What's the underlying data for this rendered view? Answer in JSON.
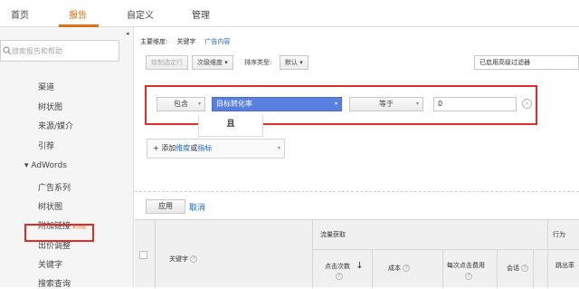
{
  "topnav": {
    "tabs": [
      "首页",
      "报告",
      "自定义",
      "管理"
    ],
    "active_color": "#e0710f"
  },
  "sidebar": {
    "collapse_glyph": "◂",
    "search_placeholder": "搜索报告和帮助",
    "items": [
      "渠道",
      "树状图",
      "来源/媒介",
      "引荐"
    ],
    "group": "▾ AdWords",
    "adwords_items": [
      "广告系列",
      "树状图",
      "附加链接",
      "出价调整",
      "关键字",
      "搜索查询"
    ],
    "new_badge": "新功能",
    "selected": "关键字"
  },
  "main": {
    "primary_dim_label": "主要维度:",
    "primary_dim_value": "关键字",
    "alt_dim_link": "广告内容",
    "toolbar": {
      "plot_rows": "绘制选定行",
      "secondary_dim": "次级维度 ▾",
      "sort_label": "排序类型:",
      "sort_value": "默认 ▾",
      "advanced_filter": "已启用高级过滤器"
    },
    "filter": {
      "include": "包含",
      "metric": "目标转化率",
      "operator": "等于",
      "value": "0",
      "close": "×"
    },
    "and_label": "且",
    "add_dim_prefix": "+ 添加",
    "add_dim_link1": "维度",
    "add_dim_or": "或",
    "add_dim_link2": "指标",
    "apply": "应用",
    "cancel": "取消"
  },
  "table": {
    "group_acquisition": "流量获取",
    "group_behavior": "行为",
    "col_keyword": "关键字",
    "col_clicks": "点击次数",
    "col_cost": "成本",
    "col_cpc": "每次点击费用",
    "col_sessions": "会话",
    "col_bounce": "跳出率",
    "sort_arrow": "↓",
    "help": "?"
  }
}
